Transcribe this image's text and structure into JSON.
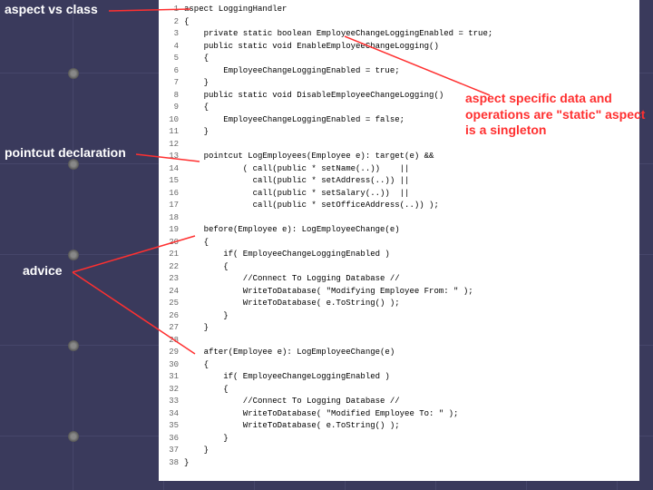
{
  "annotations": {
    "a1": "aspect vs class",
    "a2": "pointcut declaration",
    "a3": "advice",
    "a4": "aspect specific data and operations are \"static\" aspect is a singleton"
  },
  "code": [
    "aspect LoggingHandler",
    "{",
    "    private static boolean EmployeeChangeLoggingEnabled = true;",
    "    public static void EnableEmployeeChangeLogging()",
    "    {",
    "        EmployeeChangeLoggingEnabled = true;",
    "    }",
    "    public static void DisableEmployeeChangeLogging()",
    "    {",
    "        EmployeeChangeLoggingEnabled = false;",
    "    }",
    "",
    "    pointcut LogEmployees(Employee e): target(e) &&",
    "            ( call(public * setName(..))    ||",
    "              call(public * setAddress(..)) ||",
    "              call(public * setSalary(..))  ||",
    "              call(public * setOfficeAddress(..)) );",
    "",
    "    before(Employee e): LogEmployeeChange(e)",
    "    {",
    "        if( EmployeeChangeLoggingEnabled )",
    "        {",
    "            //Connect To Logging Database //",
    "            WriteToDatabase( \"Modifying Employee From: \" );",
    "            WriteToDatabase( e.ToString() );",
    "        }",
    "    }",
    "",
    "    after(Employee e): LogEmployeeChange(e)",
    "    {",
    "        if( EmployeeChangeLoggingEnabled )",
    "        {",
    "            //Connect To Logging Database //",
    "            WriteToDatabase( \"Modified Employee To: \" );",
    "            WriteToDatabase( e.ToString() );",
    "        }",
    "    }",
    "}"
  ]
}
